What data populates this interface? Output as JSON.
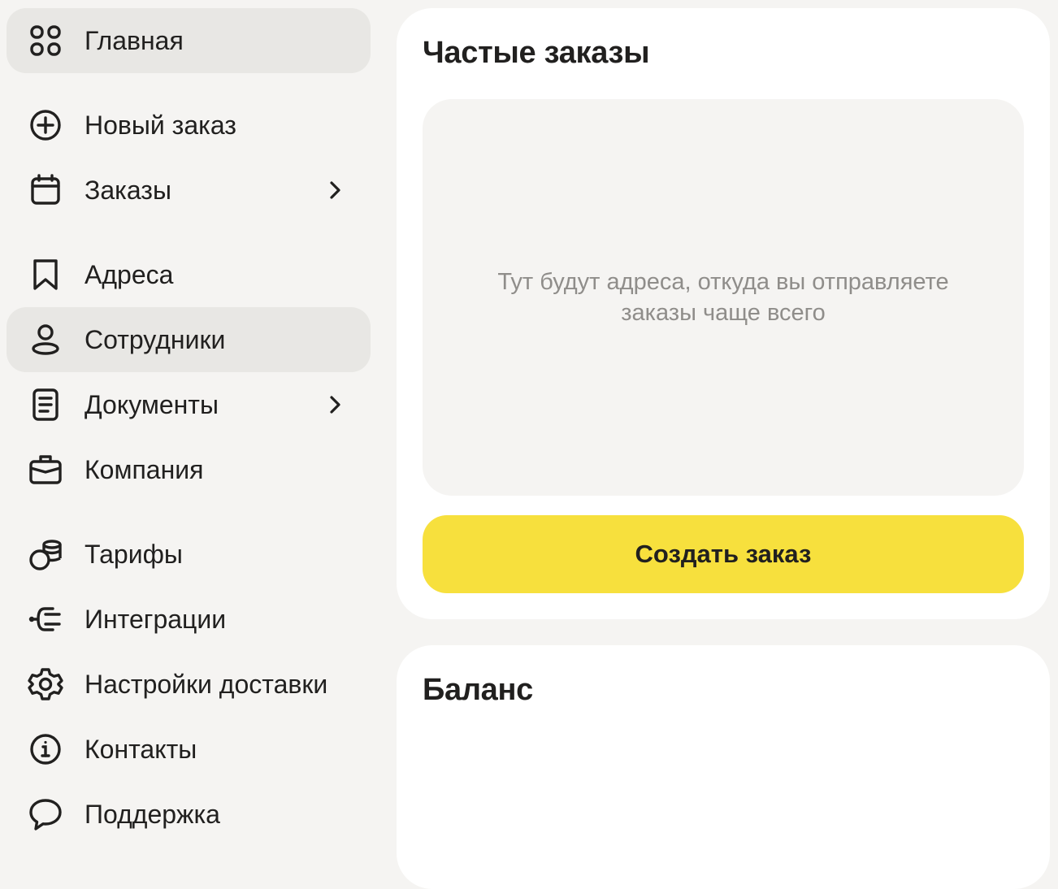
{
  "sidebar": {
    "items": [
      {
        "label": "Главная",
        "icon": "grid-icon",
        "active": true
      },
      {
        "label": "Новый заказ",
        "icon": "plus-circle-icon"
      },
      {
        "label": "Заказы",
        "icon": "calendar-icon",
        "has_chevron": true
      },
      {
        "label": "Адреса",
        "icon": "bookmark-icon"
      },
      {
        "label": "Сотрудники",
        "icon": "user-icon",
        "hovered": true
      },
      {
        "label": "Документы",
        "icon": "document-icon",
        "has_chevron": true
      },
      {
        "label": "Компания",
        "icon": "briefcase-icon"
      },
      {
        "label": "Тарифы",
        "icon": "coins-icon"
      },
      {
        "label": "Интеграции",
        "icon": "plug-icon"
      },
      {
        "label": "Настройки доставки",
        "icon": "gear-icon"
      },
      {
        "label": "Контакты",
        "icon": "info-icon"
      },
      {
        "label": "Поддержка",
        "icon": "chat-bubble-icon"
      }
    ]
  },
  "frequent_orders": {
    "title": "Частые заказы",
    "empty_text": "Тут будут адреса, откуда вы отправляете заказы чаще всего",
    "create_button": "Создать заказ"
  },
  "balance": {
    "title": "Баланс"
  },
  "colors": {
    "background": "#f5f4f2",
    "card": "#ffffff",
    "active_item": "#e8e7e4",
    "accent_yellow": "#f7e03d",
    "text": "#21201f",
    "muted_text": "#8f8d8a"
  }
}
